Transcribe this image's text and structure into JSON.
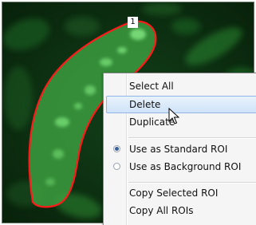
{
  "image_panel": {
    "roi_number": "1",
    "roi_outline_color": "#ff1a1a",
    "background_color": "#0b2a0c",
    "cell_color": "#3cb33c"
  },
  "context_menu": {
    "items": [
      {
        "label": "Select All"
      },
      {
        "label": "Delete",
        "highlighted": true
      },
      {
        "label": "Duplicate"
      },
      {
        "label": "Use as Standard ROI",
        "radio": "checked"
      },
      {
        "label": "Use as Background ROI",
        "radio": "unchecked"
      },
      {
        "label": "Copy Selected ROI"
      },
      {
        "label": "Copy All ROIs"
      }
    ],
    "highlight_color": "#cfe3f8"
  },
  "cursor": {
    "icon": "arrow-pointer-icon"
  }
}
